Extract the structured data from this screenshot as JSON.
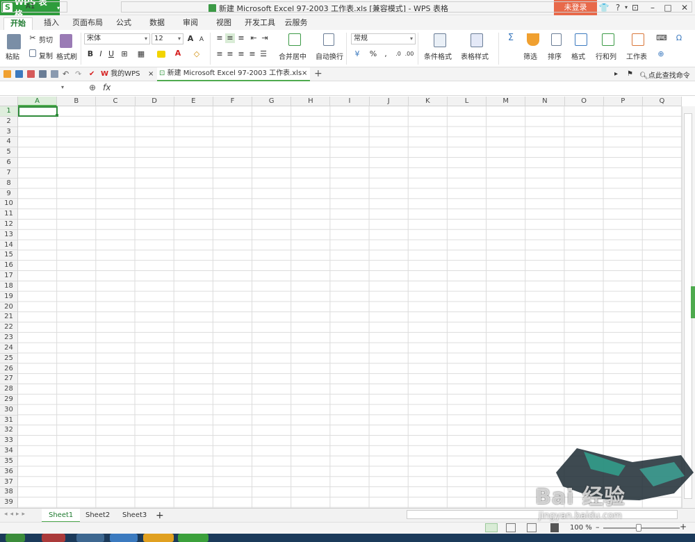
{
  "app": {
    "name": "WPS 表格",
    "logo": "S",
    "title": "新建 Microsoft Excel 97-2003 工作表.xls [兼容模式] - WPS 表格",
    "login": "未登录"
  },
  "titlebar_icons": [
    "tshirt-icon",
    "help-icon",
    "more-icon",
    "restore-icon",
    "minimize-icon",
    "maximize-icon",
    "close-icon"
  ],
  "tabs": [
    "开始",
    "插入",
    "页面布局",
    "公式",
    "数据",
    "审阅",
    "视图",
    "开发工具",
    "云服务"
  ],
  "ribbon": {
    "paste": "粘贴",
    "cut": "剪切",
    "copy": "复制",
    "format_painter": "格式刷",
    "font_name": "宋体",
    "font_size": "12",
    "bold": "B",
    "italic": "I",
    "underline": "U",
    "merge": "合并居中",
    "wrap": "自动换行",
    "number_format": "常规",
    "percent": "%",
    "cond_format": "条件格式",
    "table_style": "表格样式",
    "sum": "Σ",
    "filter": "筛选",
    "sort": "排序",
    "format": "格式",
    "rows_cols": "行和列",
    "worksheet": "工作表"
  },
  "doc_tabs": [
    {
      "label": "我的WPS"
    },
    {
      "label": "新建 Microsoft Excel 97-2003 工作表.xls"
    }
  ],
  "quick_right": {
    "search": "点此查找命令"
  },
  "formula": {
    "name_box": "A1",
    "fx": "fx",
    "value": ""
  },
  "columns": [
    "A",
    "B",
    "C",
    "D",
    "E",
    "F",
    "G",
    "H",
    "I",
    "J",
    "K",
    "L",
    "M",
    "N",
    "O",
    "P",
    "Q"
  ],
  "rows": [
    "1",
    "2",
    "3",
    "4",
    "5",
    "6",
    "7",
    "8",
    "9",
    "10",
    "11",
    "12",
    "13",
    "14",
    "15",
    "16",
    "17",
    "18",
    "19",
    "20",
    "21",
    "22",
    "23",
    "24",
    "25",
    "26",
    "27",
    "28",
    "29",
    "30",
    "31",
    "32",
    "33",
    "34",
    "35",
    "36",
    "37",
    "38",
    "39"
  ],
  "selected_cell": "A1",
  "sheets": [
    "Sheet1",
    "Sheet2",
    "Sheet3"
  ],
  "add_sheet": "+",
  "status": {
    "zoom": "100 %"
  },
  "watermark": {
    "brand": "Bai 经验",
    "url": "jingyan.baidu.com"
  },
  "colors": {
    "accent": "#2e9c3c",
    "login": "#e8694a",
    "selection": "#2e8b3a"
  }
}
